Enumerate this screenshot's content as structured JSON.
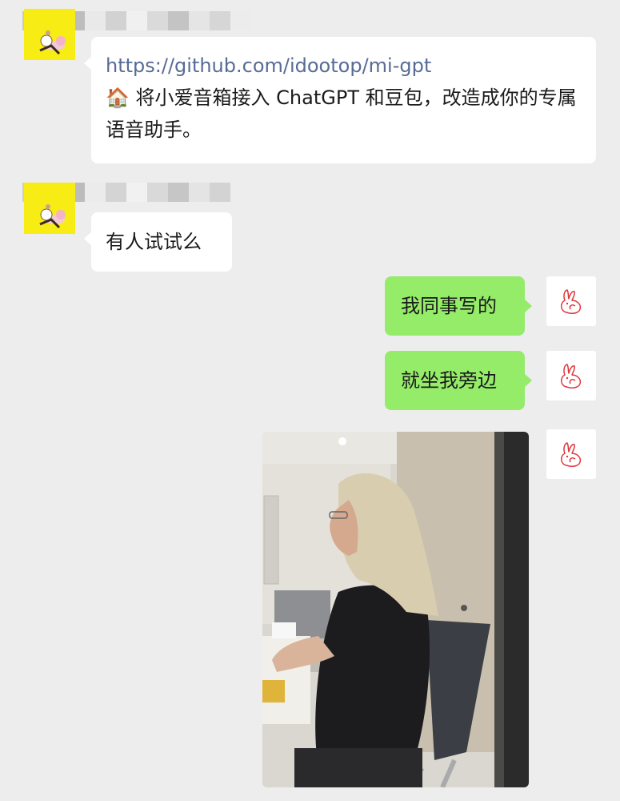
{
  "messages": [
    {
      "side": "left",
      "sender": "redacted",
      "link": "https://github.com/idootop/mi-gpt",
      "emoji": "🏠",
      "text": "将小爱音箱接入 ChatGPT 和豆包，改造成你的专属语音助手。"
    },
    {
      "side": "left",
      "sender": "redacted",
      "text": "有人试试么"
    },
    {
      "side": "right",
      "text": "我同事写的"
    },
    {
      "side": "right",
      "text": "就坐我旁边"
    },
    {
      "side": "right",
      "type": "image",
      "image_subject": "photo of a long-haired person sitting at a desk in an office"
    }
  ],
  "avatars": {
    "left": "yellow-cartoon-avatar",
    "right": "red-rabbit-outline-avatar"
  },
  "colors": {
    "background": "#ededed",
    "incoming_bubble": "#ffffff",
    "outgoing_bubble": "#95ec69",
    "link": "#576b95",
    "avatar_left_bg": "#f7ec13",
    "rabbit_stroke": "#e0353b"
  }
}
